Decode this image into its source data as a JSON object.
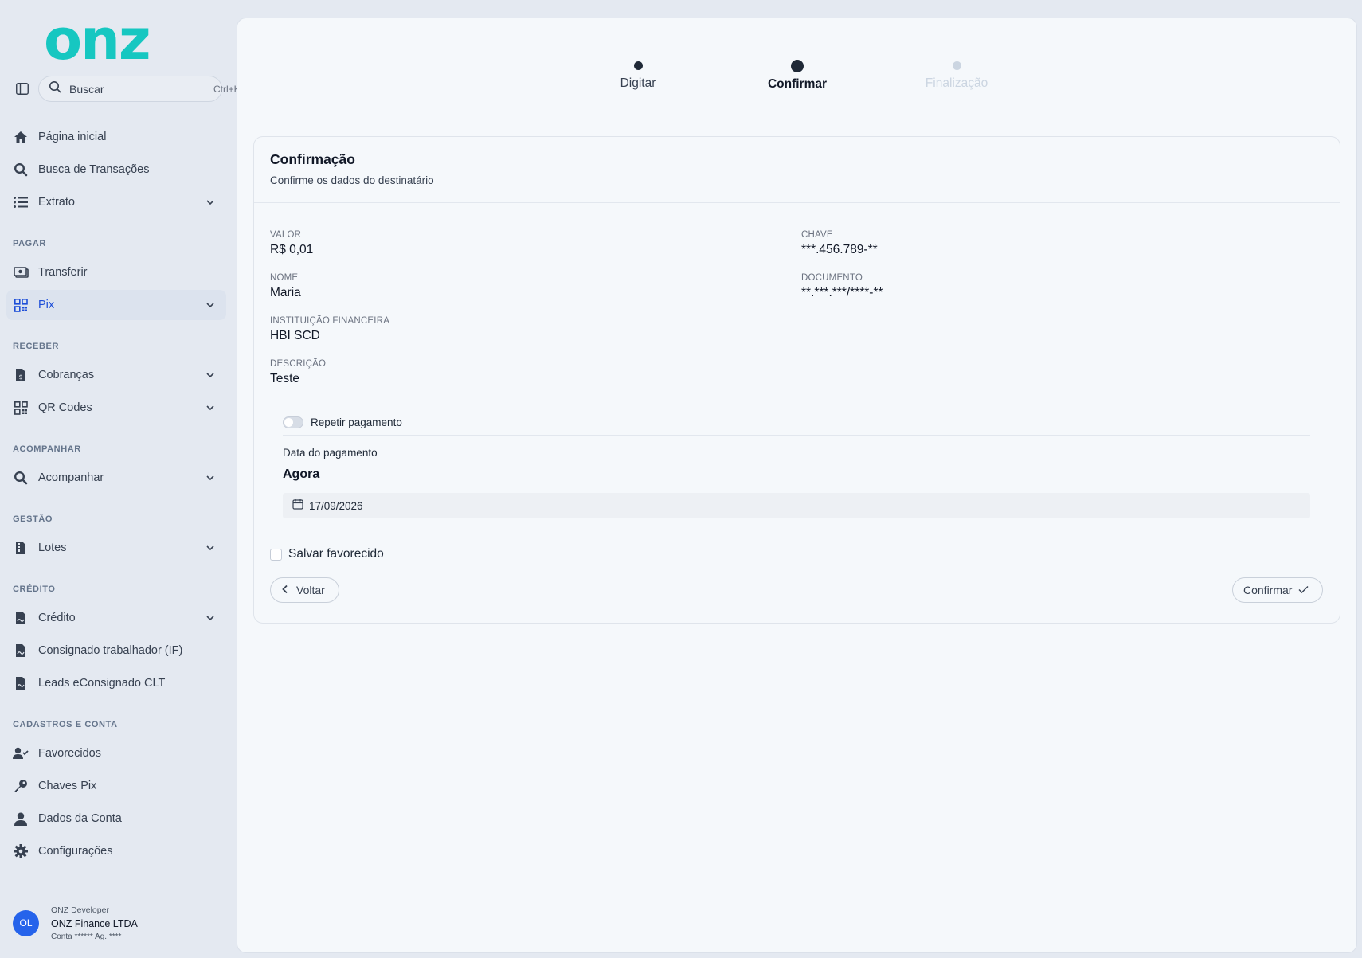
{
  "brand": {
    "logo_text": "onz",
    "color": "#16c7c1"
  },
  "sidebar": {
    "search": {
      "placeholder": "Buscar",
      "shortcut": "Ctrl+K"
    },
    "nav_top": [
      {
        "label": "Página inicial",
        "icon": "home-icon"
      },
      {
        "label": "Busca de Transações",
        "icon": "search-icon"
      },
      {
        "label": "Extrato",
        "icon": "list-icon",
        "expandable": true
      }
    ],
    "sections": {
      "pagar": "PAGAR",
      "receber": "RECEBER",
      "acompanhar": "ACOMPANHAR",
      "gestao": "GESTÃO",
      "credito": "CRÉDITO",
      "cadastros": "CADASTROS E CONTA"
    },
    "items": {
      "transferir": "Transferir",
      "pix": "Pix",
      "cobrancas": "Cobranças",
      "qr_codes": "QR Codes",
      "acompanhar": "Acompanhar",
      "lotes": "Lotes",
      "credito": "Crédito",
      "consignado": "Consignado trabalhador (IF)",
      "leads": "Leads eConsignado CLT",
      "favorecidos": "Favorecidos",
      "chaves_pix": "Chaves Pix",
      "dados_conta": "Dados da Conta",
      "configuracoes": "Configurações"
    },
    "user": {
      "initials": "OL",
      "developer": "ONZ Developer",
      "company": "ONZ Finance LTDA",
      "account": "Conta ****** Ag. ****"
    }
  },
  "stepper": {
    "steps": [
      "Digitar",
      "Confirmar",
      "Finalização"
    ],
    "current": 1
  },
  "confirm": {
    "title": "Confirmação",
    "subtitle": "Confirme os dados do destinatário",
    "fields": {
      "valor_label": "VALOR",
      "valor": "R$ 0,01",
      "chave_label": "CHAVE",
      "chave": "***.456.789-**",
      "nome_label": "NOME",
      "nome": "Maria",
      "documento_label": "DOCUMENTO",
      "documento": "**.***.***/****-**",
      "instituicao_label": "INSTITUIÇÃO FINANCEIRA",
      "instituicao": "HBI SCD",
      "descricao_label": "DESCRIÇÃO",
      "descricao": "Teste"
    },
    "repeat_label": "Repetir pagamento",
    "repeat_on": false,
    "date_label": "Data do pagamento",
    "date_option": "Agora",
    "date_value": "17/09/2026",
    "save_favorite_label": "Salvar favorecido",
    "back_label": "Voltar",
    "confirm_label": "Confirmar"
  },
  "colors": {
    "accent": "#1d4ed8",
    "avatar": "#2563eb",
    "background": "#e4e9f1",
    "panel": "#f5f8fb"
  }
}
